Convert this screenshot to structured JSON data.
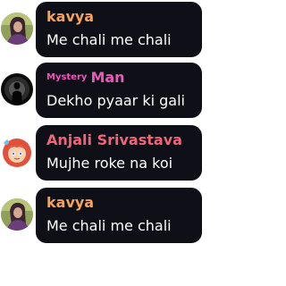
{
  "messages": [
    {
      "sender": "kavya",
      "sender_color": "#f6a25c",
      "text": "Me chali me chali",
      "avatar_icon": "user-photo-icon"
    },
    {
      "sender_prefix": "Mystery",
      "sender": "Man",
      "sender_color": "#e957b8",
      "text": "Dekho pyaar ki gali",
      "avatar_icon": "silhouette-icon"
    },
    {
      "sender": "Anjali Srivastava",
      "sender_color": "#f0647a",
      "text": "Mujhe roke na koi",
      "avatar_icon": "cartoon-girl-icon"
    },
    {
      "sender": "kavya",
      "sender_color": "#f6a25c",
      "text": "Me chali me chali",
      "avatar_icon": "user-photo-icon"
    }
  ]
}
